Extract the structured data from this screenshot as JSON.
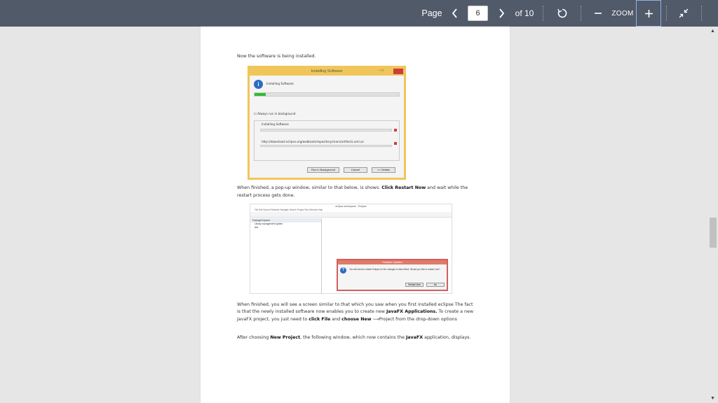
{
  "toolbar": {
    "page_label": "Page",
    "prev_icon": "chevron-left-icon",
    "page_value": "6",
    "next_icon": "chevron-right-icon",
    "of_label": "of 10",
    "rotate_icon": "rotate-icon",
    "zoom_out_icon": "minus-icon",
    "zoom_label": "ZOOM",
    "zoom_in_icon": "plus-icon",
    "collapse_icon": "collapse-arrows-icon"
  },
  "document": {
    "para1": "Now the software is being installed.",
    "para2_pre": "When finished, a pop-up window, similar to that below, is shows. ",
    "para2_bold": "Click Restart Now",
    "para2_post": " and wait while the restart process gets done.",
    "para3_a": "When finished, you will see a screen similar to that which you saw when you first installed eclipse The fact is that the newly installed software now enables you to create new ",
    "para3_b": "JavaFX Applications.",
    "para3_c": " To create a new JavaFX project, you just need to ",
    "para3_d": "click File",
    "para3_e": " and ",
    "para3_f": "choose New",
    "para3_g": "Project from the drop-down options",
    "para4_a": "After choosing ",
    "para4_b": "New Project",
    "para4_c": ", the following window, which now contains the ",
    "para4_d": "JavaFX",
    "para4_e": " application, displays."
  },
  "screenshot1": {
    "title": "Installing Software",
    "heading": "Installing Software",
    "progress": 0.08,
    "checkbox_label": "Always run in background",
    "group_label": "Installing Software",
    "url": "http://download.eclipse.org/webtools/repository/mars/artifacts.xml.xz",
    "btn_background": "Run in Background",
    "btn_cancel": "Cancel",
    "btn_details": "<< Details"
  },
  "screenshot2": {
    "title": "eclipse-workspace - Eclipse",
    "menu": "File  Edit  Source  Refactor  Navigate  Search  Project  Run  Window  Help",
    "pane_header": "Package Explorer",
    "tree_item1": "Library management system",
    "tree_item2": "test",
    "dialog_title": "Software Updates",
    "dialog_msg": "You will need to restart Eclipse for the changes to take effect. Would you like to restart now?",
    "btn_restart": "Restart Now",
    "btn_no": "No"
  },
  "scrollbar": {
    "up_icon": "scroll-up-arrow-icon",
    "down_icon": "scroll-down-arrow-icon"
  },
  "colors": {
    "toolbar_bg": "#515a69",
    "highlight_border": "#f0c65a",
    "progress_green": "#2ebd2e",
    "close_red": "#c9403a"
  }
}
